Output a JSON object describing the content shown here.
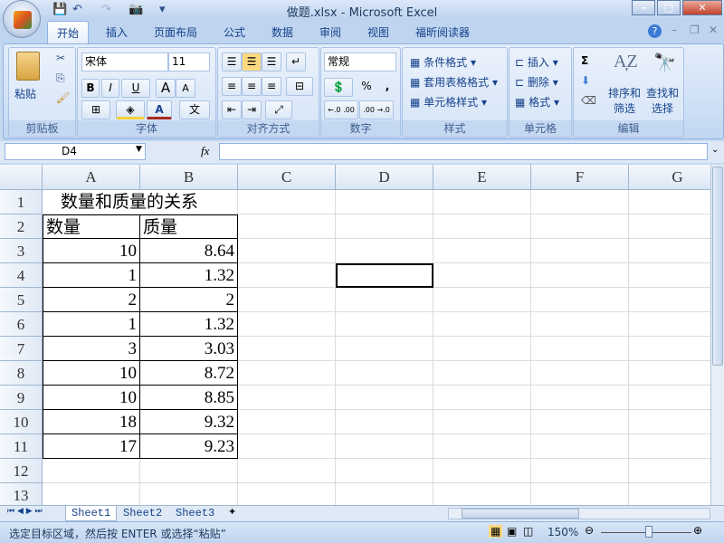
{
  "window": {
    "title": "做题.xlsx - Microsoft Excel",
    "min": "–",
    "max": "□",
    "close": "✕"
  },
  "quick_access": {
    "save": "💾",
    "undo": "↶",
    "redo": "↷",
    "camera": "📷",
    "more": "▾"
  },
  "tabs": [
    "开始",
    "插入",
    "页面布局",
    "公式",
    "数据",
    "审阅",
    "视图",
    "福昕阅读器"
  ],
  "ribbon": {
    "clipboard": {
      "paste": "粘贴",
      "label": "剪贴板"
    },
    "font": {
      "name": "宋体",
      "size": "11",
      "bold": "B",
      "italic": "I",
      "underline": "U",
      "grow": "A",
      "shrink": "A",
      "font_color": "A",
      "phonetic": "文",
      "label": "字体"
    },
    "alignment": {
      "label": "对齐方式"
    },
    "number": {
      "format": "常规",
      "percent": "%",
      "comma": ",",
      "inc": "←.0 .00",
      "dec": ".00 →.0",
      "label": "数字"
    },
    "styles": {
      "conditional": "条件格式",
      "table": "套用表格格式",
      "cell": "单元格样式",
      "label": "样式"
    },
    "cells": {
      "insert": "插入",
      "delete": "删除",
      "format": "格式",
      "label": "单元格"
    },
    "editing": {
      "sum": "Σ",
      "sort1": "排序和",
      "sort2": "筛选",
      "find1": "查找和",
      "find2": "选择",
      "label": "编辑"
    }
  },
  "formula_bar": {
    "name_box": "D4",
    "fx": "fx",
    "value": ""
  },
  "columns": [
    "A",
    "B",
    "C",
    "D",
    "E",
    "F",
    "G"
  ],
  "rows": [
    "1",
    "2",
    "3",
    "4",
    "5",
    "6",
    "7",
    "8",
    "9",
    "10",
    "11",
    "12",
    "13"
  ],
  "sheet": {
    "title": "数量和质量的关系",
    "headers": [
      "数量",
      "质量"
    ],
    "data": [
      [
        "10",
        "8.64"
      ],
      [
        "1",
        "1.32"
      ],
      [
        "2",
        "2"
      ],
      [
        "1",
        "1.32"
      ],
      [
        "3",
        "3.03"
      ],
      [
        "10",
        "8.72"
      ],
      [
        "10",
        "8.85"
      ],
      [
        "18",
        "9.32"
      ],
      [
        "17",
        "9.23"
      ]
    ]
  },
  "sheet_tabs": [
    "Sheet1",
    "Sheet2",
    "Sheet3"
  ],
  "status": {
    "message": "选定目标区域，然后按 ENTER 或选择“粘贴”",
    "zoom": "150%"
  }
}
